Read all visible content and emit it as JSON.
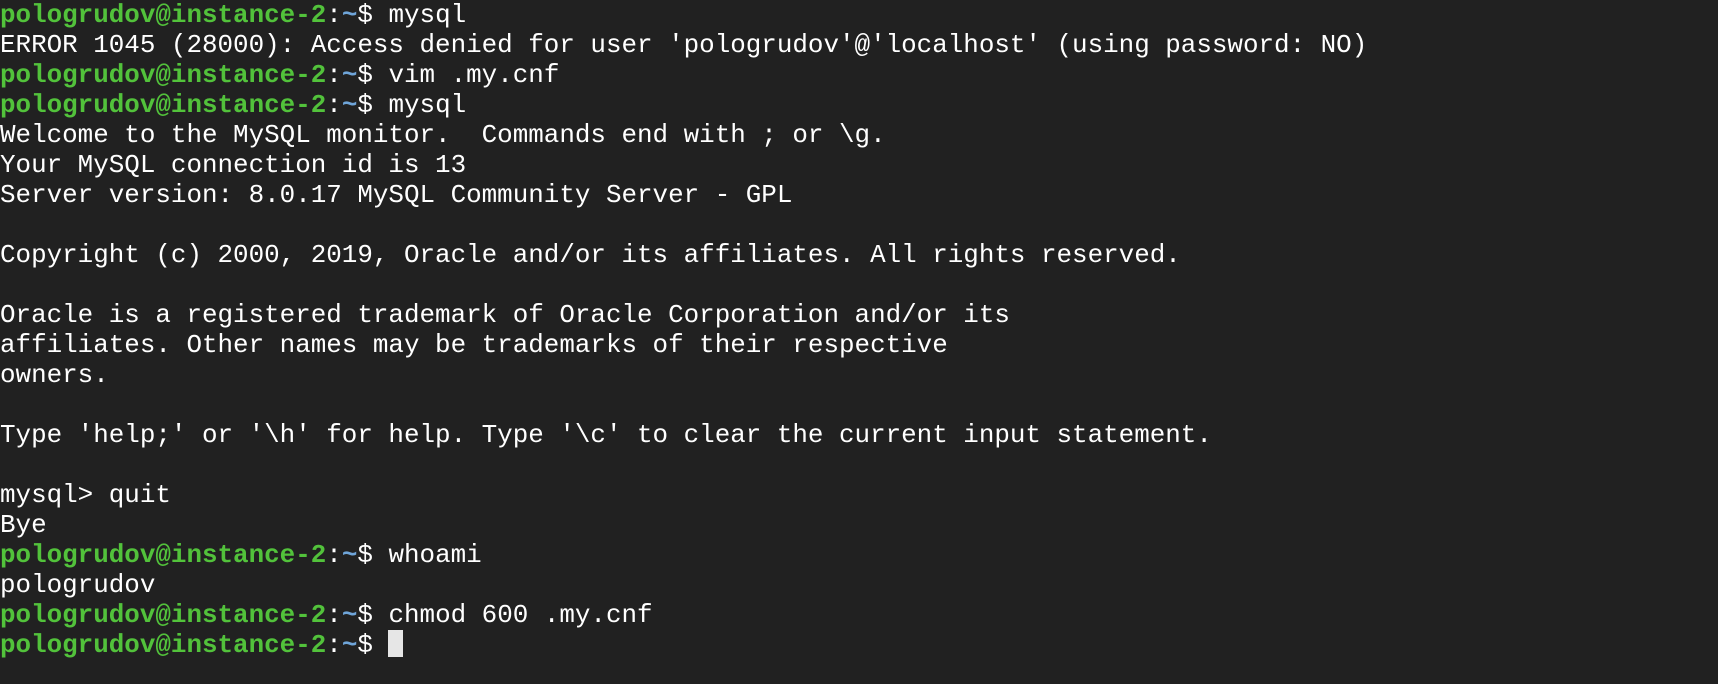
{
  "colors": {
    "background": "#212121",
    "text": "#ffffff",
    "prompt_user": "#52c23b",
    "prompt_path": "#6fa5d9",
    "cursor": "#e6e6e6"
  },
  "prompt": {
    "user_host": "pologrudov@instance-2",
    "colon": ":",
    "path": "~",
    "symbol": "$ "
  },
  "lines": [
    {
      "type": "prompt",
      "command": "mysql"
    },
    {
      "type": "output",
      "text": "ERROR 1045 (28000): Access denied for user 'pologrudov'@'localhost' (using password: NO)"
    },
    {
      "type": "prompt",
      "command": "vim .my.cnf"
    },
    {
      "type": "prompt",
      "command": "mysql"
    },
    {
      "type": "output",
      "text": "Welcome to the MySQL monitor.  Commands end with ; or \\g."
    },
    {
      "type": "output",
      "text": "Your MySQL connection id is 13"
    },
    {
      "type": "output",
      "text": "Server version: 8.0.17 MySQL Community Server - GPL"
    },
    {
      "type": "output",
      "text": ""
    },
    {
      "type": "output",
      "text": "Copyright (c) 2000, 2019, Oracle and/or its affiliates. All rights reserved."
    },
    {
      "type": "output",
      "text": ""
    },
    {
      "type": "output",
      "text": "Oracle is a registered trademark of Oracle Corporation and/or its"
    },
    {
      "type": "output",
      "text": "affiliates. Other names may be trademarks of their respective"
    },
    {
      "type": "output",
      "text": "owners."
    },
    {
      "type": "output",
      "text": ""
    },
    {
      "type": "output",
      "text": "Type 'help;' or '\\h' for help. Type '\\c' to clear the current input statement."
    },
    {
      "type": "output",
      "text": ""
    },
    {
      "type": "output",
      "text": "mysql> quit"
    },
    {
      "type": "output",
      "text": "Bye"
    },
    {
      "type": "prompt",
      "command": "whoami"
    },
    {
      "type": "output",
      "text": "pologrudov"
    },
    {
      "type": "prompt",
      "command": "chmod 600 .my.cnf"
    },
    {
      "type": "prompt",
      "command": "",
      "cursor": true
    }
  ]
}
